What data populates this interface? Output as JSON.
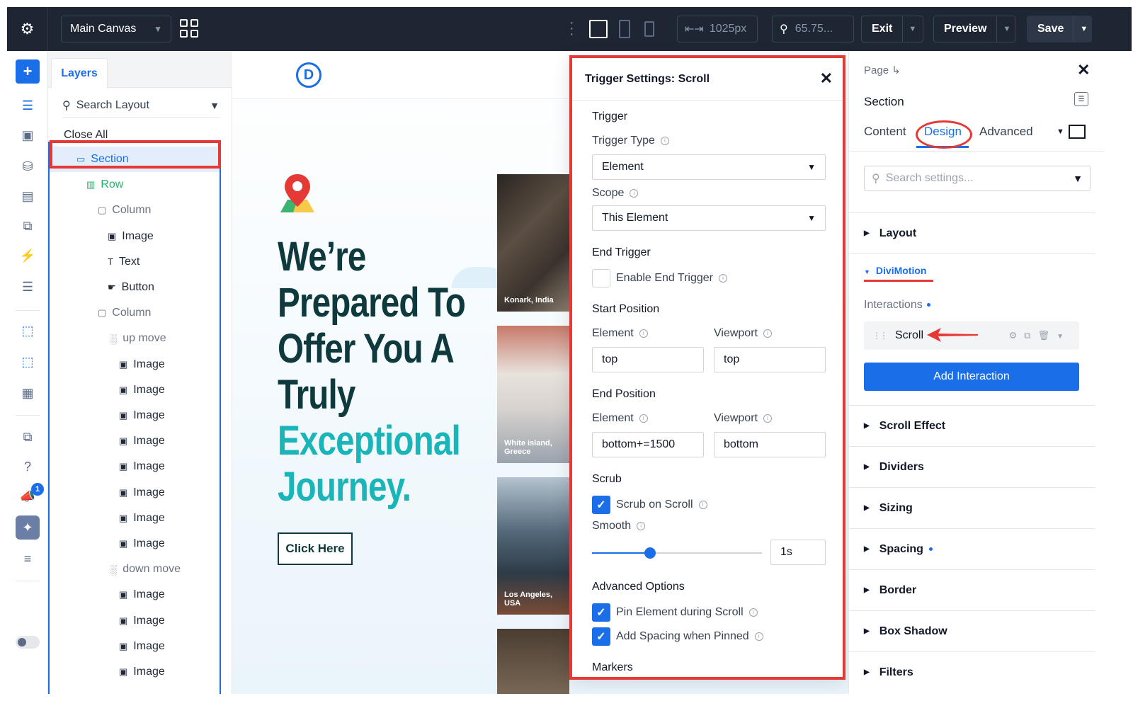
{
  "topbar": {
    "canvas_label": "Main Canvas",
    "width_value": "1025px",
    "zoom_value": "65.75...",
    "exit_label": "Exit",
    "preview_label": "Preview",
    "save_label": "Save"
  },
  "rail": {
    "notification_count": "1"
  },
  "layers": {
    "tab_label": "Layers",
    "search_placeholder": "Search Layout",
    "close_all": "Close All",
    "tree": [
      {
        "label": "Section",
        "kind": "section"
      },
      {
        "label": "Row",
        "kind": "row"
      },
      {
        "label": "Column",
        "kind": "column"
      },
      {
        "label": "Image",
        "kind": "image"
      },
      {
        "label": "Text",
        "kind": "text"
      },
      {
        "label": "Button",
        "kind": "button"
      },
      {
        "label": "Column",
        "kind": "column"
      },
      {
        "label": "up move",
        "kind": "group"
      },
      {
        "label": "Image",
        "kind": "image"
      },
      {
        "label": "Image",
        "kind": "image"
      },
      {
        "label": "Image",
        "kind": "image"
      },
      {
        "label": "Image",
        "kind": "image"
      },
      {
        "label": "Image",
        "kind": "image"
      },
      {
        "label": "Image",
        "kind": "image"
      },
      {
        "label": "Image",
        "kind": "image"
      },
      {
        "label": "Image",
        "kind": "image"
      },
      {
        "label": "down move",
        "kind": "group"
      },
      {
        "label": "Image",
        "kind": "image"
      },
      {
        "label": "Image",
        "kind": "image"
      },
      {
        "label": "Image",
        "kind": "image"
      },
      {
        "label": "Image",
        "kind": "image"
      }
    ]
  },
  "canvas": {
    "logo_letter": "D",
    "hero_line1": "We’re",
    "hero_line2": "Prepared To",
    "hero_line3": "Offer You A",
    "hero_line4": "Truly",
    "hero_line5": "Exceptional",
    "hero_line6": "Journey.",
    "cta_label": "Click Here",
    "photo_captions": [
      "Konark, India",
      "White island, Greece",
      "Los Angeles, USA",
      ""
    ]
  },
  "trigger_modal": {
    "title": "Trigger Settings: Scroll",
    "trigger_section": "Trigger",
    "trigger_type_label": "Trigger Type",
    "trigger_type_value": "Element",
    "scope_label": "Scope",
    "scope_value": "This Element",
    "end_trigger_section": "End Trigger",
    "enable_end_trigger_label": "Enable End Trigger",
    "enable_end_trigger_checked": false,
    "start_position_section": "Start Position",
    "start_element_label": "Element",
    "start_element_value": "top",
    "start_viewport_label": "Viewport",
    "start_viewport_value": "top",
    "end_position_section": "End Position",
    "end_element_label": "Element",
    "end_element_value": "bottom+=1500",
    "end_viewport_label": "Viewport",
    "end_viewport_value": "bottom",
    "scrub_section": "Scrub",
    "scrub_on_scroll_label": "Scrub on Scroll",
    "scrub_on_scroll_checked": true,
    "smooth_label": "Smooth",
    "smooth_value": "1s",
    "smooth_slider_fraction": 0.34,
    "advanced_section": "Advanced Options",
    "pin_label": "Pin Element during Scroll",
    "pin_checked": true,
    "spacing_label": "Add Spacing when Pinned",
    "spacing_checked": true,
    "markers_section": "Markers"
  },
  "right_panel": {
    "breadcrumb": "Page",
    "title": "Section",
    "tabs": [
      "Content",
      "Design",
      "Advanced"
    ],
    "active_tab": "Design",
    "search_placeholder": "Search settings...",
    "layout_label": "Layout",
    "divimotion_label": "DiviMotion",
    "interactions_label": "Interactions",
    "interaction_item": "Scroll",
    "add_interaction_label": "Add Interaction",
    "sections": [
      "Scroll Effect",
      "Dividers",
      "Sizing",
      "Spacing",
      "Border",
      "Box Shadow",
      "Filters"
    ]
  },
  "colors": {
    "accent": "#1a6fe8",
    "annotation_red": "#e53935",
    "topbar_bg": "#1e2633",
    "hero_dark": "#0f3a3d",
    "hero_teal": "#1ab5b8"
  }
}
